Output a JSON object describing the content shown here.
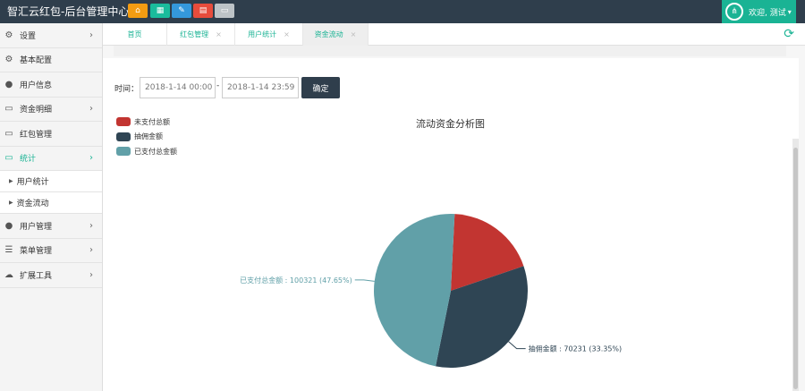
{
  "header": {
    "title": "智汇云红包-后台管理中心",
    "quick_icons": [
      {
        "name": "home-icon",
        "glyph": "⌂",
        "color": "#f39c12"
      },
      {
        "name": "grid-icon",
        "glyph": "▦",
        "color": "#1abc9c"
      },
      {
        "name": "edit-icon",
        "glyph": "✎",
        "color": "#3498db"
      },
      {
        "name": "file-icon",
        "glyph": "▤",
        "color": "#e74c3c"
      },
      {
        "name": "window-icon",
        "glyph": "▭",
        "color": "#bdc3c7"
      }
    ],
    "user_label": "欢迎, 测试",
    "user_icon": "share-icon"
  },
  "sidebar": {
    "items": [
      {
        "label": "设置",
        "icon": "gear-icon",
        "glyph": "⚙",
        "arrow": true
      },
      {
        "label": "基本配置",
        "icon": "gear-icon",
        "glyph": "⚙",
        "arrow": false
      },
      {
        "label": "用户信息",
        "icon": "users-icon",
        "glyph": "👥",
        "arrow": false
      },
      {
        "label": "资金明细",
        "icon": "monitor-icon",
        "glyph": "▭",
        "arrow": true
      },
      {
        "label": "红包管理",
        "icon": "monitor-icon",
        "glyph": "▭",
        "arrow": false
      },
      {
        "label": "统计",
        "icon": "monitor-icon",
        "glyph": "▭",
        "arrow": true,
        "active": true
      }
    ],
    "subitems": [
      "用户统计",
      "资金流动"
    ],
    "items_after": [
      {
        "label": "用户管理",
        "icon": "users-icon",
        "glyph": "👥",
        "arrow": true
      },
      {
        "label": "菜单管理",
        "icon": "list-icon",
        "glyph": "☰",
        "arrow": true
      },
      {
        "label": "扩展工具",
        "icon": "cloud-icon",
        "glyph": "☁",
        "arrow": true
      }
    ]
  },
  "tabs": [
    {
      "label": "首页"
    },
    {
      "label": "红包管理"
    },
    {
      "label": "用户统计"
    },
    {
      "label": "资金流动",
      "active": true
    }
  ],
  "filter": {
    "label": "时间：",
    "start": "2018-1-14 00:00",
    "end": "2018-1-14 23:59",
    "separator": "-",
    "confirm_label": "确定"
  },
  "chart_data": {
    "type": "pie",
    "title": "流动资金分析图",
    "legend": [
      "未支付总额",
      "抽佣金额",
      "已支付总金额"
    ],
    "colors": [
      "#c23531",
      "#2f4554",
      "#61a0a8"
    ],
    "slices": [
      {
        "name": "未支付总额",
        "value": 40000,
        "percent": 19.0
      },
      {
        "name": "抽佣金额",
        "value": 70231,
        "percent": 33.35
      },
      {
        "name": "已支付总金额",
        "value": 100321,
        "percent": 47.65
      }
    ],
    "labels": [
      "抽佣金额 : 70231 (33.35%)",
      "已支付总金额 : 100321 (47.65%)"
    ]
  }
}
